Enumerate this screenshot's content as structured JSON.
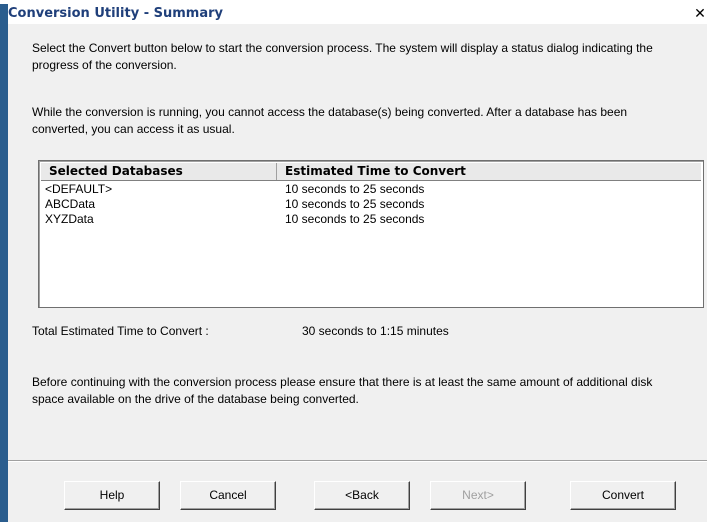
{
  "window": {
    "title": "Conversion Utility - Summary",
    "close_glyph": "✕"
  },
  "intro": {
    "paragraph_1": "Select the Convert button below to start the conversion process. The system will display a status dialog indicating the progress of the conversion.",
    "paragraph_2": "While the conversion is running, you cannot access the database(s) being converted. After a database has been converted, you can access it as usual."
  },
  "table": {
    "columns": [
      "Selected Databases",
      "Estimated Time to Convert"
    ],
    "rows": [
      {
        "name": "<DEFAULT>",
        "time": "10 seconds  to  25 seconds"
      },
      {
        "name": "ABCData",
        "time": "10 seconds  to  25 seconds"
      },
      {
        "name": "XYZData",
        "time": "10 seconds  to  25 seconds"
      }
    ]
  },
  "total": {
    "label": "Total Estimated Time to Convert :",
    "value": "30 seconds  to  1:15 minutes"
  },
  "notice": {
    "paragraph": "Before continuing with the conversion process please ensure that there is at least the same amount of additional disk space available on the drive of the database being converted."
  },
  "buttons": {
    "help": "Help",
    "cancel": "Cancel",
    "back": "<Back",
    "next": "Next>",
    "convert": "Convert"
  },
  "colors": {
    "title_text": "#1f3f7a",
    "window_border": "#2a5d8e",
    "disabled_text": "#a0a0a0"
  }
}
